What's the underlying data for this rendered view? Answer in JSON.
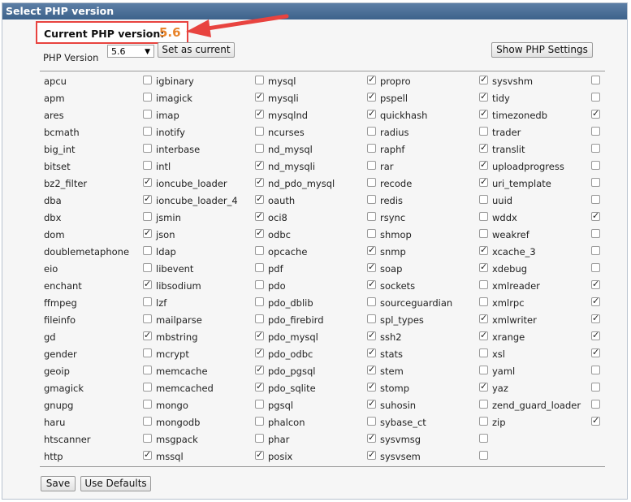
{
  "title": "Select PHP version",
  "current": {
    "label": "Current PHP version:",
    "value": "5.6"
  },
  "version_label": "PHP Version",
  "version_selected": "5.6",
  "set_current_label": "Set as current",
  "show_settings_label": "Show PHP Settings",
  "save_label": "Save",
  "defaults_label": "Use Defaults",
  "columns": [
    [
      {
        "name": "apcu",
        "checked": false
      },
      {
        "name": "apm",
        "checked": false
      },
      {
        "name": "ares",
        "checked": false
      },
      {
        "name": "bcmath",
        "checked": false
      },
      {
        "name": "big_int",
        "checked": false
      },
      {
        "name": "bitset",
        "checked": false
      },
      {
        "name": "bz2_filter",
        "checked": true
      },
      {
        "name": "dba",
        "checked": true
      },
      {
        "name": "dbx",
        "checked": false
      },
      {
        "name": "dom",
        "checked": true
      },
      {
        "name": "doublemetaphone",
        "checked": false
      },
      {
        "name": "eio",
        "checked": false
      },
      {
        "name": "enchant",
        "checked": true
      },
      {
        "name": "ffmpeg",
        "checked": false
      },
      {
        "name": "fileinfo",
        "checked": false
      },
      {
        "name": "gd",
        "checked": true
      },
      {
        "name": "gender",
        "checked": false
      },
      {
        "name": "geoip",
        "checked": false
      },
      {
        "name": "gmagick",
        "checked": false
      },
      {
        "name": "gnupg",
        "checked": false
      },
      {
        "name": "haru",
        "checked": false
      },
      {
        "name": "htscanner",
        "checked": false
      },
      {
        "name": "http",
        "checked": true
      }
    ],
    [
      {
        "name": "igbinary",
        "checked": false
      },
      {
        "name": "imagick",
        "checked": true
      },
      {
        "name": "imap",
        "checked": true
      },
      {
        "name": "inotify",
        "checked": false
      },
      {
        "name": "interbase",
        "checked": false
      },
      {
        "name": "intl",
        "checked": true
      },
      {
        "name": "ioncube_loader",
        "checked": true
      },
      {
        "name": "ioncube_loader_4",
        "checked": true
      },
      {
        "name": "jsmin",
        "checked": true
      },
      {
        "name": "json",
        "checked": true
      },
      {
        "name": "ldap",
        "checked": false
      },
      {
        "name": "libevent",
        "checked": false
      },
      {
        "name": "libsodium",
        "checked": false
      },
      {
        "name": "lzf",
        "checked": false
      },
      {
        "name": "mailparse",
        "checked": false
      },
      {
        "name": "mbstring",
        "checked": true
      },
      {
        "name": "mcrypt",
        "checked": true
      },
      {
        "name": "memcache",
        "checked": true
      },
      {
        "name": "memcached",
        "checked": true
      },
      {
        "name": "mongo",
        "checked": false
      },
      {
        "name": "mongodb",
        "checked": false
      },
      {
        "name": "msgpack",
        "checked": false
      },
      {
        "name": "mssql",
        "checked": true
      }
    ],
    [
      {
        "name": "mysql",
        "checked": true
      },
      {
        "name": "mysqli",
        "checked": true
      },
      {
        "name": "mysqlnd",
        "checked": true
      },
      {
        "name": "ncurses",
        "checked": false
      },
      {
        "name": "nd_mysql",
        "checked": false
      },
      {
        "name": "nd_mysqli",
        "checked": false
      },
      {
        "name": "nd_pdo_mysql",
        "checked": false
      },
      {
        "name": "oauth",
        "checked": false
      },
      {
        "name": "oci8",
        "checked": false
      },
      {
        "name": "odbc",
        "checked": false
      },
      {
        "name": "opcache",
        "checked": true
      },
      {
        "name": "pdf",
        "checked": true
      },
      {
        "name": "pdo",
        "checked": true
      },
      {
        "name": "pdo_dblib",
        "checked": false
      },
      {
        "name": "pdo_firebird",
        "checked": false
      },
      {
        "name": "pdo_mysql",
        "checked": true
      },
      {
        "name": "pdo_odbc",
        "checked": true
      },
      {
        "name": "pdo_pgsql",
        "checked": true
      },
      {
        "name": "pdo_sqlite",
        "checked": true
      },
      {
        "name": "pgsql",
        "checked": true
      },
      {
        "name": "phalcon",
        "checked": false
      },
      {
        "name": "phar",
        "checked": true
      },
      {
        "name": "posix",
        "checked": true
      }
    ],
    [
      {
        "name": "propro",
        "checked": true
      },
      {
        "name": "pspell",
        "checked": true
      },
      {
        "name": "quickhash",
        "checked": true
      },
      {
        "name": "radius",
        "checked": false
      },
      {
        "name": "raphf",
        "checked": true
      },
      {
        "name": "rar",
        "checked": true
      },
      {
        "name": "recode",
        "checked": true
      },
      {
        "name": "redis",
        "checked": false
      },
      {
        "name": "rsync",
        "checked": false
      },
      {
        "name": "shmop",
        "checked": false
      },
      {
        "name": "snmp",
        "checked": true
      },
      {
        "name": "soap",
        "checked": true
      },
      {
        "name": "sockets",
        "checked": false
      },
      {
        "name": "sourceguardian",
        "checked": false
      },
      {
        "name": "spl_types",
        "checked": true
      },
      {
        "name": "ssh2",
        "checked": true
      },
      {
        "name": "stats",
        "checked": false
      },
      {
        "name": "stem",
        "checked": false
      },
      {
        "name": "stomp",
        "checked": true
      },
      {
        "name": "suhosin",
        "checked": false
      },
      {
        "name": "sybase_ct",
        "checked": false
      },
      {
        "name": "sysvmsg",
        "checked": false
      },
      {
        "name": "sysvsem",
        "checked": false
      }
    ],
    [
      {
        "name": "sysvshm",
        "checked": false
      },
      {
        "name": "tidy",
        "checked": false
      },
      {
        "name": "timezonedb",
        "checked": true
      },
      {
        "name": "trader",
        "checked": false
      },
      {
        "name": "translit",
        "checked": false
      },
      {
        "name": "uploadprogress",
        "checked": false
      },
      {
        "name": "uri_template",
        "checked": false
      },
      {
        "name": "uuid",
        "checked": false
      },
      {
        "name": "wddx",
        "checked": true
      },
      {
        "name": "weakref",
        "checked": false
      },
      {
        "name": "xcache_3",
        "checked": false
      },
      {
        "name": "xdebug",
        "checked": false
      },
      {
        "name": "xmlreader",
        "checked": true
      },
      {
        "name": "xmlrpc",
        "checked": true
      },
      {
        "name": "xmlwriter",
        "checked": true
      },
      {
        "name": "xrange",
        "checked": true
      },
      {
        "name": "xsl",
        "checked": true
      },
      {
        "name": "yaml",
        "checked": false
      },
      {
        "name": "yaz",
        "checked": false
      },
      {
        "name": "zend_guard_loader",
        "checked": false
      },
      {
        "name": "zip",
        "checked": true
      }
    ]
  ],
  "colors": {
    "title_bar": "#4a6e96",
    "highlight_border": "#e8433f",
    "version_value": "#e8842b"
  }
}
